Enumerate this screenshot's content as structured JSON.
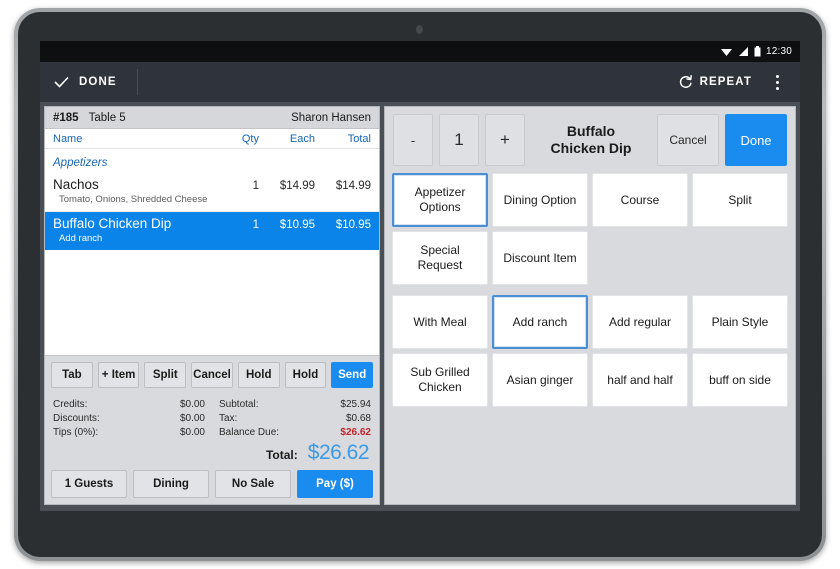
{
  "status_bar": {
    "clock": "12:30",
    "icons": [
      "wifi-icon",
      "signal-icon",
      "battery-icon"
    ]
  },
  "app_bar": {
    "done_label": "DONE",
    "done_icon": "check-icon",
    "repeat_label": "REPEAT",
    "repeat_icon": "refresh-icon",
    "overflow_icon": "more-vertical-icon"
  },
  "order": {
    "number": "#185",
    "table": "Table 5",
    "server": "Sharon Hansen",
    "columns": {
      "name": "Name",
      "qty": "Qty",
      "each": "Each",
      "total": "Total"
    },
    "group_label": "Appetizers",
    "items": [
      {
        "name": "Nachos",
        "qty": "1",
        "each": "$14.99",
        "total": "$14.99",
        "mods": "Tomato, Onions, Shredded Cheese",
        "selected": false
      },
      {
        "name": "Buffalo Chicken Dip",
        "qty": "1",
        "each": "$10.95",
        "total": "$10.95",
        "mods": "Add ranch",
        "selected": true
      }
    ],
    "actions": [
      "Tab",
      "+ Item",
      "Split",
      "Cancel",
      "Hold",
      "Hold"
    ],
    "send_label": "Send",
    "totals_left": [
      {
        "label": "Credits:",
        "value": "$0.00"
      },
      {
        "label": "Discounts:",
        "value": "$0.00"
      },
      {
        "label": "Tips (0%):",
        "value": "$0.00"
      }
    ],
    "totals_right": [
      {
        "label": "Subtotal:",
        "value": "$25.94"
      },
      {
        "label": "Tax:",
        "value": "$0.68"
      },
      {
        "label": "Balance Due:",
        "value": "$26.62"
      }
    ],
    "grand_label": "Total:",
    "grand_value": "$26.62",
    "bottom_buttons": [
      "1 Guests",
      "Dining",
      "No Sale"
    ],
    "pay_label": "Pay ($)"
  },
  "modifier": {
    "minus_label": "-",
    "qty_value": "1",
    "plus_label": "+",
    "title": "Buffalo\nChicken Dip",
    "title_line1": "Buffalo",
    "title_line2": "Chicken Dip",
    "cancel_label": "Cancel",
    "done_label": "Done",
    "groups": [
      {
        "label": "Appetizer Options",
        "selected": true
      },
      {
        "label": "Dining Option",
        "selected": false
      },
      {
        "label": "Course",
        "selected": false
      },
      {
        "label": "Split",
        "selected": false
      },
      {
        "label": "Special Request",
        "selected": false
      },
      {
        "label": "Discount Item",
        "selected": false
      },
      {
        "label": "",
        "selected": false
      },
      {
        "label": "",
        "selected": false
      }
    ],
    "options": [
      {
        "label": "With Meal",
        "selected": false
      },
      {
        "label": "Add ranch",
        "selected": true
      },
      {
        "label": "Add regular",
        "selected": false
      },
      {
        "label": "Plain Style",
        "selected": false
      },
      {
        "label": "Sub Grilled Chicken",
        "selected": false
      },
      {
        "label": "Asian ginger",
        "selected": false
      },
      {
        "label": "half and half",
        "selected": false
      },
      {
        "label": "buff on side",
        "selected": false
      }
    ]
  },
  "colors": {
    "accent_blue": "#0a84e8",
    "button_blue": "#1a8cf0",
    "link_blue": "#1766b4",
    "total_blue": "#3d9ae8",
    "danger_red": "#c1272d",
    "appbar_dark": "#2f333b",
    "selection_border": "#4a8fd4"
  }
}
